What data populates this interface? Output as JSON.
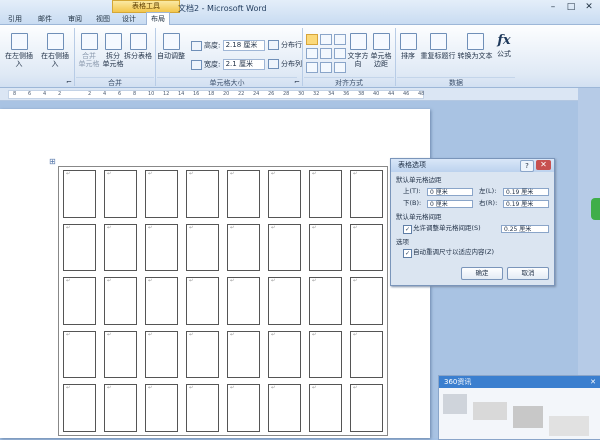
{
  "window": {
    "context_tab_group": "表格工具",
    "doc_title": "文档2 - Microsoft Word",
    "tabs": [
      "引用",
      "邮件",
      "审阅",
      "视图",
      "设计",
      "布局"
    ],
    "active_tab": "布局",
    "controls": {
      "minimize": "–",
      "maximize": "□",
      "close": "✕"
    }
  },
  "ribbon": {
    "rows_cols": {
      "insert_left": "在左侧插入",
      "insert_right": "在右侧插入",
      "dialog_launcher": "⌐"
    },
    "merge": {
      "merge_cells": "合并\n单元格",
      "split_cells": "拆分\n单元格",
      "split_table": "拆分表格",
      "label": "合并"
    },
    "autofit": {
      "label": "自动调整"
    },
    "cell_size": {
      "height_label": "高度:",
      "height_value": "2.18 厘米",
      "width_label": "宽度:",
      "width_value": "2.1 厘米",
      "distribute_rows": "分布行",
      "distribute_cols": "分布列",
      "label": "单元格大小",
      "dialog_launcher": "⌐"
    },
    "alignment": {
      "text_direction": "文字方向",
      "cell_margins": "单元格\n边距",
      "label": "对齐方式"
    },
    "data": {
      "sort": "排序",
      "repeat_header": "重复标题行",
      "convert_to_text": "转换为文本",
      "formula": "公式",
      "formula_icon_text": "fx",
      "label": "数据"
    }
  },
  "ruler": {
    "ticks": [
      "8",
      "6",
      "4",
      "2",
      "",
      "2",
      "4",
      "6",
      "8",
      "10",
      "12",
      "14",
      "16",
      "18",
      "20",
      "22",
      "24",
      "26",
      "28",
      "30",
      "32",
      "34",
      "36",
      "38",
      "40",
      "44",
      "46",
      "48"
    ]
  },
  "table": {
    "rows": 5,
    "cols": 8,
    "cell_mark": "↵",
    "move_handle": "⊞"
  },
  "dialog": {
    "title": "表格选项",
    "help": "?",
    "close": "✕",
    "default_margins_label": "默认单元格边距",
    "top_label": "上(T):",
    "top_value": "0 厘米",
    "left_label": "左(L):",
    "left_value": "0.19 厘米",
    "bottom_label": "下(B):",
    "bottom_value": "0 厘米",
    "right_label": "右(R):",
    "right_value": "0.19 厘米",
    "default_spacing_label": "默认单元格间距",
    "allow_spacing_label": "允许调整单元格间距(S)",
    "allow_spacing_checked": true,
    "spacing_value": "0.25 厘米",
    "options_label": "选项",
    "auto_resize_label": "自动重调尺寸以适应内容(Z)",
    "auto_resize_checked": true,
    "ok": "确定",
    "cancel": "取消"
  },
  "side_panel": {
    "title": "360资讯",
    "close": "✕"
  },
  "colors": {
    "accent": "#3b7fcf",
    "context_tab": "#f3c64d",
    "selected_align": "#fbd97a"
  }
}
